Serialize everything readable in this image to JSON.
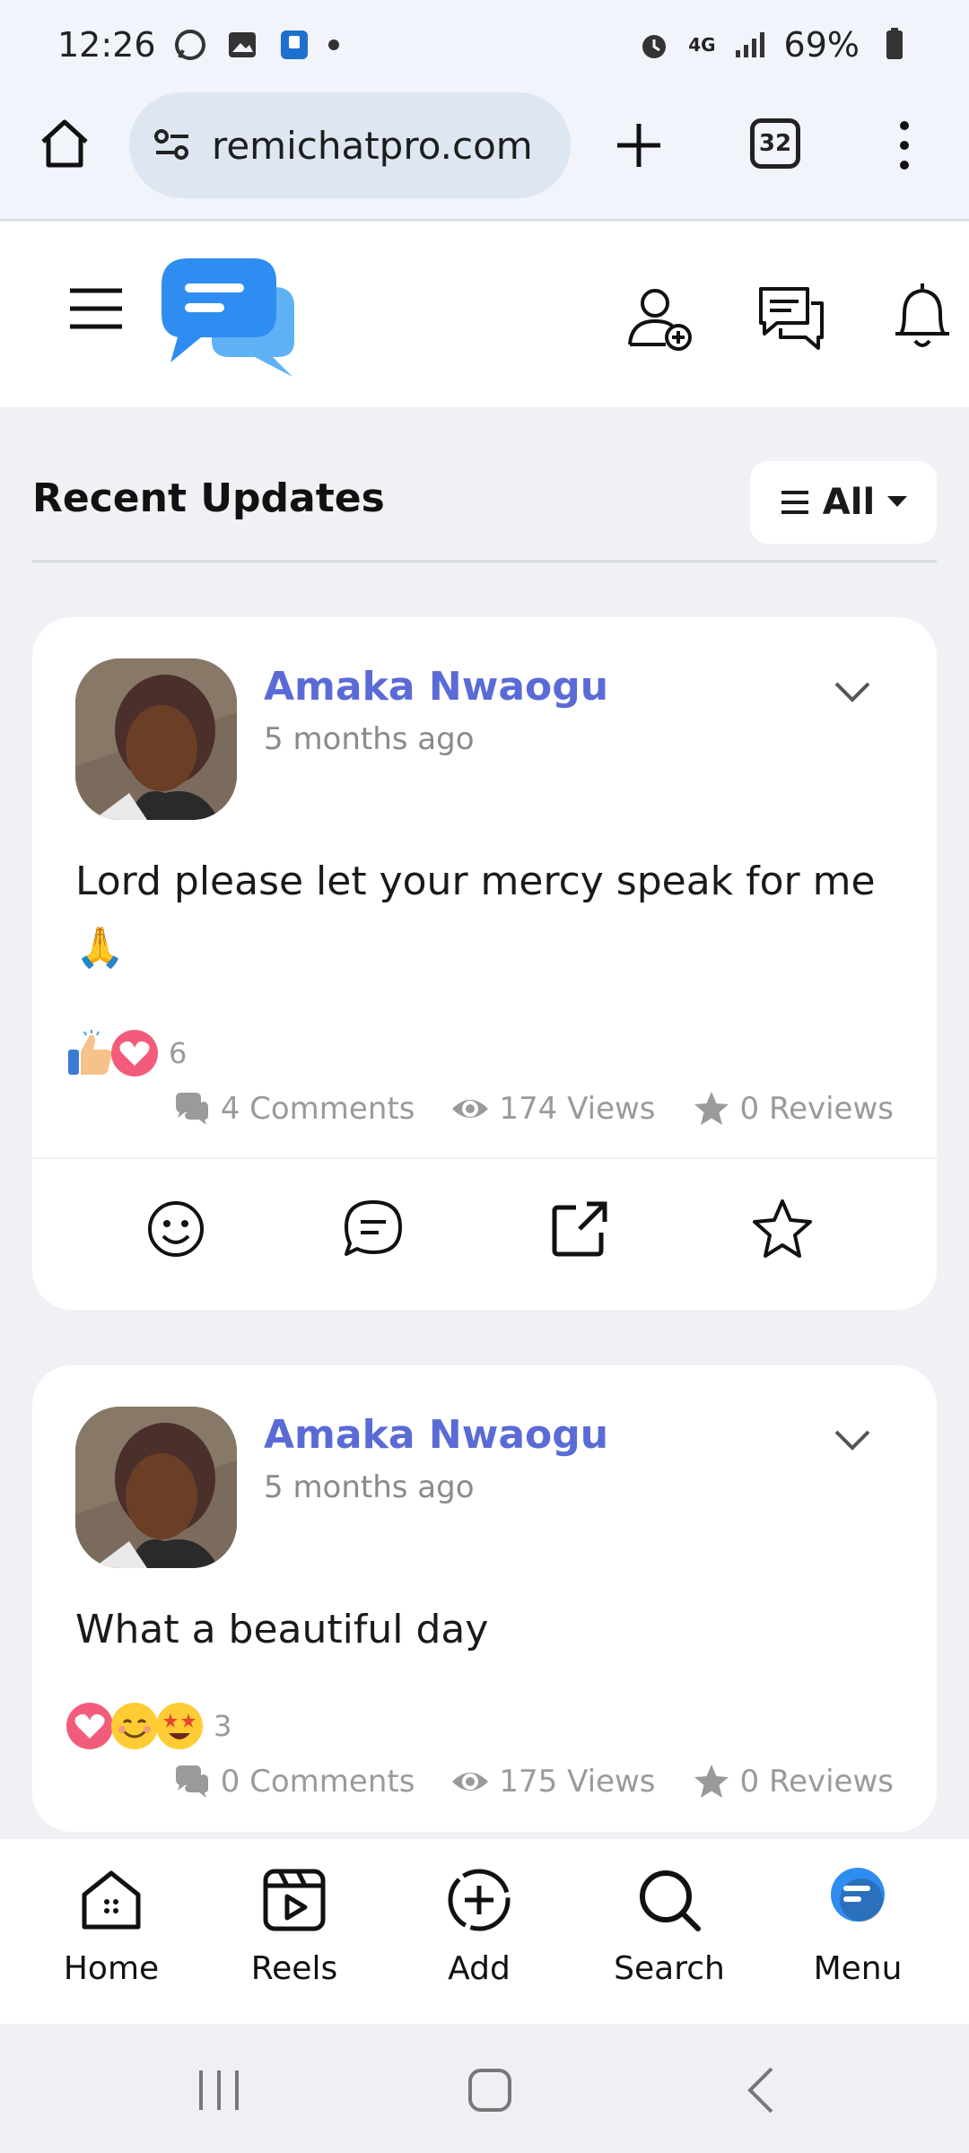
{
  "status_bar": {
    "time": "12:26",
    "network": "4G",
    "battery": "69%"
  },
  "browser": {
    "url": "remichatpro.com",
    "tab_count": "32"
  },
  "section": {
    "title": "Recent Updates",
    "filter_label": "All"
  },
  "posts": [
    {
      "author": "Amaka Nwaogu",
      "time": "5 months ago",
      "text": "Lord please let your mercy speak for me",
      "emoji": "🙏",
      "reaction_count": "6",
      "reactions": [
        "thumbs-up",
        "heart"
      ],
      "comments": "4 Comments",
      "views": "174 Views",
      "reviews": "0 Reviews"
    },
    {
      "author": "Amaka Nwaogu",
      "time": "5 months ago",
      "text": "What a beautiful day",
      "reaction_count": "3",
      "reactions": [
        "heart",
        "smile",
        "star-struck"
      ],
      "comments": "0 Comments",
      "views": "175 Views",
      "reviews": "0 Reviews"
    }
  ],
  "bottom_nav": [
    {
      "label": "Home",
      "icon": "home-icon"
    },
    {
      "label": "Reels",
      "icon": "reels-icon"
    },
    {
      "label": "Add",
      "icon": "add-icon"
    },
    {
      "label": "Search",
      "icon": "search-icon"
    },
    {
      "label": "Menu",
      "icon": "menu-logo-icon"
    }
  ],
  "colors": {
    "brand_blue": "#2f8cf0",
    "author_name": "#5b6bd6",
    "muted_text": "#9a9a9a"
  }
}
